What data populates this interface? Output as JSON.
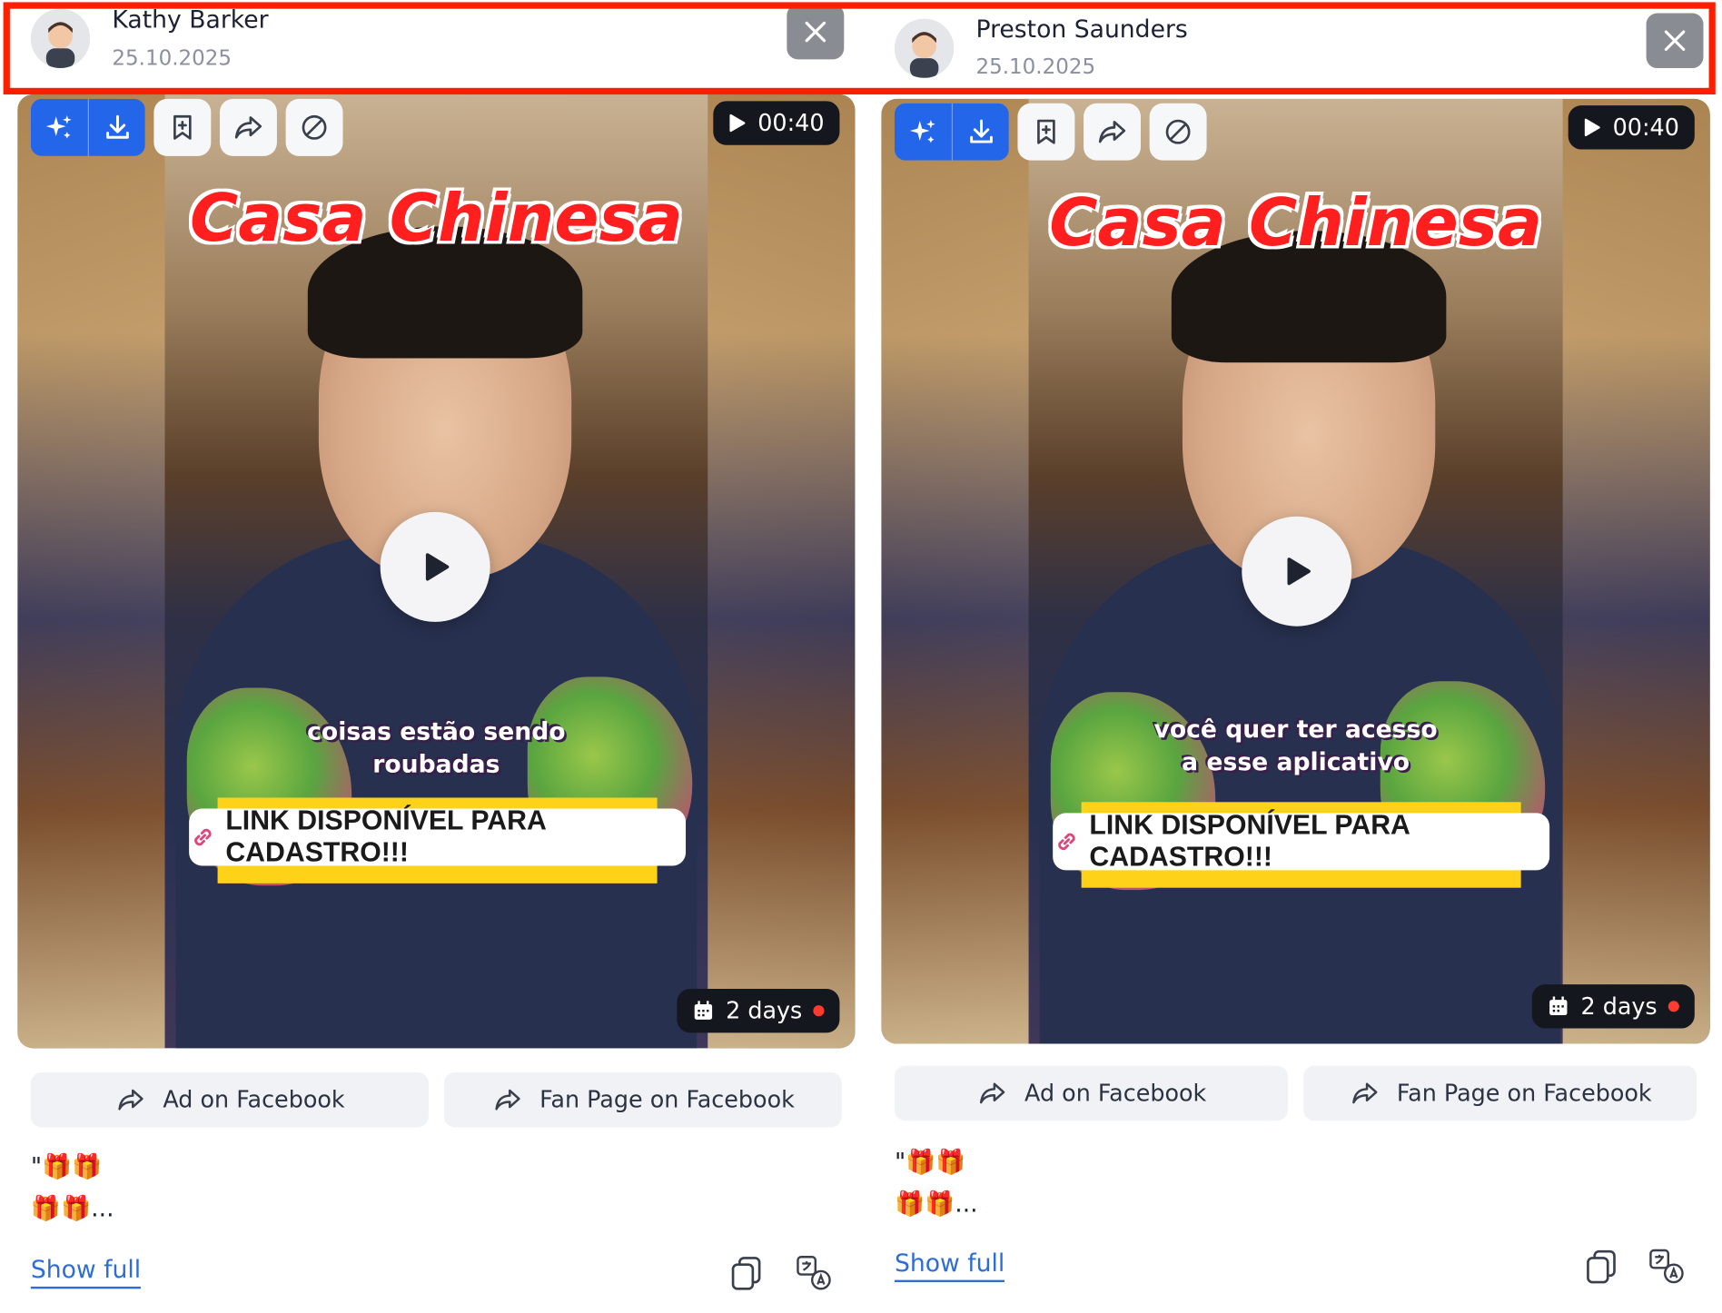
{
  "cards": [
    {
      "author_name": "Kathy Barker",
      "date": "25.10.2025",
      "duration": "00:40",
      "age": "2 days",
      "video_title": "Casa Chinesa",
      "video_caption_1": "coisas estão sendo",
      "video_caption_2": "roubadas",
      "video_banner": "LINK DISPONÍVEL PARA CADASTRO!!!",
      "ad_button": "Ad on Facebook",
      "fanpage_button": "Fan Page on Facebook",
      "desc_line_1": "\"🎁🎁",
      "desc_line_2": "🎁🎁...",
      "show_full": "Show full"
    },
    {
      "author_name": "Preston Saunders",
      "date": "25.10.2025",
      "duration": "00:40",
      "age": "2 days",
      "video_title": "Casa Chinesa",
      "video_caption_1": "você quer ter acesso",
      "video_caption_2": "a esse aplicativo",
      "video_banner": "LINK DISPONÍVEL PARA CADASTRO!!!",
      "ad_button": "Ad on Facebook",
      "fanpage_button": "Fan Page on Facebook",
      "desc_line_1": "\"🎁🎁",
      "desc_line_2": "🎁🎁...",
      "show_full": "Show full"
    }
  ],
  "icons": {
    "close": "close-icon",
    "ai": "sparkles-icon",
    "download": "download-icon",
    "bookmark": "bookmark-add-icon",
    "share": "share-icon",
    "block": "block-icon",
    "play": "play-icon",
    "calendar": "calendar-icon",
    "copy": "copy-icon",
    "translate": "translate-icon"
  },
  "colors": {
    "highlight": "#ff1f00",
    "primary": "#2466ea",
    "link": "#2e6cd6",
    "badge": "#15171f",
    "status_dot": "#ff3b30"
  }
}
